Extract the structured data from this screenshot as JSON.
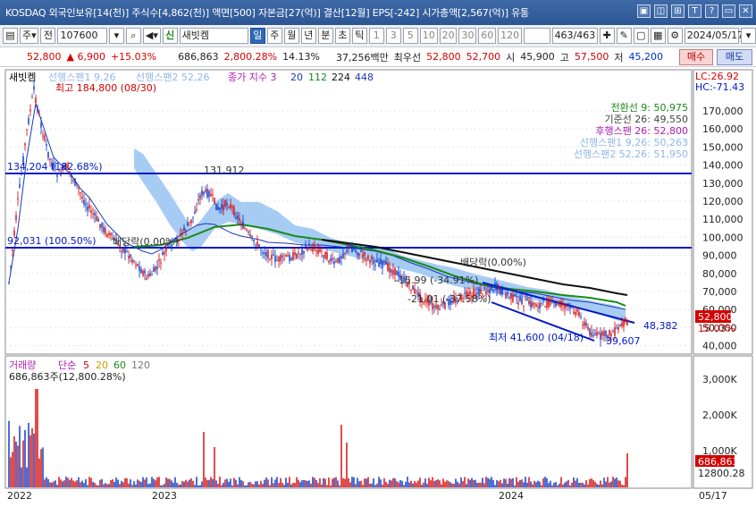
{
  "titlebar": {
    "title": "KOSDAQ 외국인보유[14(천)] 주식수[4,862(천)] 액면[500] 자본금[27(억)] 결산[12월] EPS[-242] 시가총액[2,567(억)] 유통",
    "buttons": [
      "▣",
      "◫",
      "⊞",
      "T",
      "?",
      "▭",
      "✕"
    ]
  },
  "toolbar": {
    "menu_glyph": "▤",
    "market": "주",
    "market_arrow": "▾",
    "prev_label": "전",
    "code": "107600",
    "code_arrow": "▾",
    "search_glyph": "⌕",
    "audio_glyph": "◀▾",
    "flag": "신",
    "stock_name": "새빗켐",
    "periods": [
      "일",
      "주",
      "월",
      "년",
      "분",
      "초",
      "틱"
    ],
    "intervals": [
      "1",
      "3",
      "5",
      "10",
      "20",
      "30",
      "60",
      "120"
    ],
    "counter": "463",
    "counter_total": "/463",
    "tool_icons": [
      "✚",
      "✎",
      "▢",
      "▦",
      "⚙"
    ],
    "date": "2024/05/17",
    "date_arrow": "▾"
  },
  "quote": {
    "price": "52,800",
    "change": "▲ 6,900",
    "change_pct": "+15.03%",
    "volume": "686,863",
    "volume_ratio": "2,800.28%",
    "turnover": "14.13%",
    "amount": "37,256백만",
    "pref_label": "최우선",
    "pref_ask": "52,800",
    "pref_bid": "52,700",
    "open_label": "시",
    "open": "45,900",
    "high_label": "고",
    "high": "57,500",
    "low_label": "저",
    "low": "45,200",
    "buy_label": "매수",
    "sell_label": "매도"
  },
  "chart": {
    "stock_tag": "새빗켐",
    "legend": [
      {
        "text": "선행스팬1 9,26",
        "color": "#8fb7e8"
      },
      {
        "text": "선행스팬2 52,26",
        "color": "#8fb7e8"
      },
      {
        "text": "종가 지수 3",
        "color": "#b01cb0"
      },
      {
        "text": "20",
        "color": "#1a3ab8"
      },
      {
        "text": "112",
        "color": "#1a8a1a"
      },
      {
        "text": "224",
        "color": "#111111"
      },
      {
        "text": "448",
        "color": "#1a3ab8"
      }
    ],
    "price_axis": [
      "170,000",
      "160,000",
      "150,000",
      "140,000",
      "130,000",
      "120,000",
      "110,000",
      "100,000",
      "90,000",
      "80,000",
      "70,000",
      "60,000",
      "50,000",
      "40,000"
    ],
    "lc": "LC:26.92",
    "hc": "HC:-71.43",
    "current_price_tag": "52,800",
    "current_pct_tag": "15.03%",
    "ichimoku": [
      {
        "text": "전환선 9: 50,975",
        "color": "#1a8a1a"
      },
      {
        "text": "기준선 26: 49,550",
        "color": "#444444"
      },
      {
        "text": "후행스팬 26: 52,800",
        "color": "#b01cb0"
      },
      {
        "text": "선행스팬1 9,26: 50,263",
        "color": "#8fb7e8"
      },
      {
        "text": "선행스팬2 52,26: 51,950",
        "color": "#8fb7e8"
      }
    ],
    "annotations": {
      "high": "최고 184,800 (08/30)",
      "low": "최저 41,600 (04/18)",
      "line1": "134,204 (182.68%)",
      "line2": "92,031 (100.50%)",
      "fib1": "배당락(0.00%)",
      "fib2": "배당락(0.00%)",
      "pct1": "-15.99 (-34.91%)",
      "pct2": "-21.01 (-37.58%)",
      "trend_end": "48,382",
      "trend_low": "39,607",
      "peak2": "131,912"
    },
    "volume_legend": [
      {
        "text": "거래량",
        "color": "#b01cb0"
      },
      {
        "text": "단순",
        "color": "#b01cb0"
      },
      {
        "text": "5",
        "color": "#d40000"
      },
      {
        "text": "20",
        "color": "#c8a000"
      },
      {
        "text": "60",
        "color": "#1a8a1a"
      },
      {
        "text": "120",
        "color": "#777777"
      }
    ],
    "volume_value": "686,863주(12,800.28%)",
    "volume_axis": [
      "3,000K",
      "2,000K",
      "1,000K"
    ],
    "volume_tag": "686,863",
    "volume_tag2": "12800.28",
    "x_axis": [
      "2022",
      "2023",
      "2024",
      "05/17"
    ]
  },
  "chart_data": {
    "type": "candlestick",
    "symbol": "새빗켐 107600",
    "price_range": [
      40000,
      175000
    ],
    "hlines": [
      134204,
      92031
    ],
    "high": {
      "value": 184800,
      "date": "08/30"
    },
    "low": {
      "value": 41600,
      "date": "04/18"
    },
    "x_labels": [
      "2022",
      "2023",
      "2024",
      "05/17"
    ],
    "last": {
      "close": 52800,
      "open": 45900,
      "high": 57500,
      "low": 45200,
      "volume": 686863
    }
  }
}
